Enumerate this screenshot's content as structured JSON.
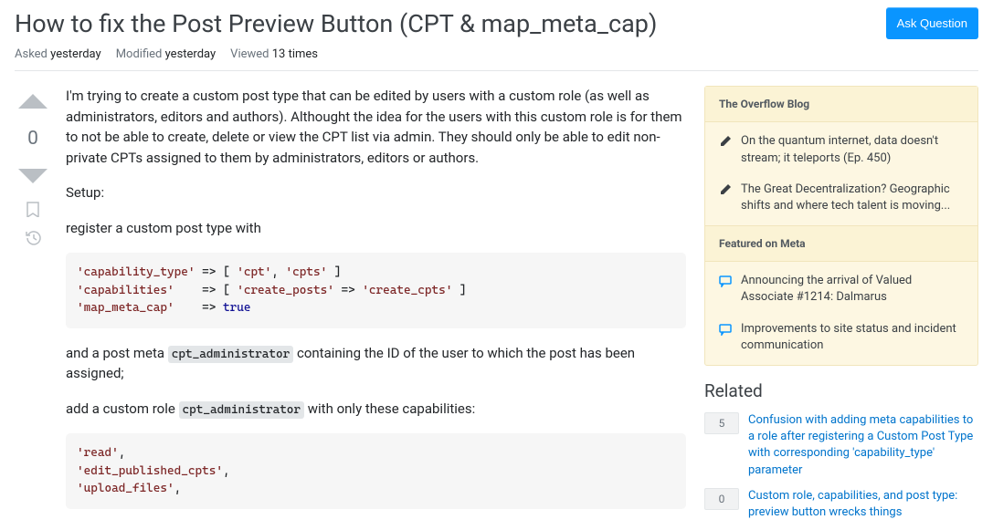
{
  "title": "How to fix the Post Preview Button (CPT & map_meta_cap)",
  "ask_button": "Ask Question",
  "stats": {
    "asked_label": "Asked",
    "asked_val": "yesterday",
    "modified_label": "Modified",
    "modified_val": "yesterday",
    "viewed_label": "Viewed",
    "viewed_val": "13 times"
  },
  "vote": {
    "count": "0"
  },
  "post": {
    "p1": "I'm trying to create a custom post type that can be edited by users with a custom role (as well as administrators, editors and authors). Althought the idea for the users with this custom role is for them to not be able to create, delete or view the CPT list via admin. They should only be able to edit non-private CPTs assigned to them by administrators, editors or authors.",
    "p2": "Setup:",
    "p3": "register a custom post type with",
    "code1_l1a": "'capability_type'",
    "code1_l1b": " => [ ",
    "code1_l1c": "'cpt'",
    "code1_l1d": ", ",
    "code1_l1e": "'cpts'",
    "code1_l1f": " ]",
    "code1_l2a": "'capabilities'",
    "code1_l2b": "    => [ ",
    "code1_l2c": "'create_posts'",
    "code1_l2d": " => ",
    "code1_l2e": "'create_cpts'",
    "code1_l2f": " ]",
    "code1_l3a": "'map_meta_cap'",
    "code1_l3b": "    => ",
    "code1_l3c": "true",
    "p4a": "and a post meta ",
    "p4code": "cpt_administrator",
    "p4b": " containing the ID of the user to which the post has been assigned;",
    "p5a": "add a custom role ",
    "p5code": "cpt_administrator",
    "p5b": " with only these capabilities:",
    "code2_l1": "'read'",
    "code2_l2": "'edit_published_cpts'",
    "code2_l3": "'upload_files'"
  },
  "sidebar": {
    "overflow_hd": "The Overflow Blog",
    "overflow": [
      {
        "text": "On the quantum internet, data doesn't stream; it teleports (Ep. 450)"
      },
      {
        "text": "The Great Decentralization? Geographic shifts and where tech talent is moving..."
      }
    ],
    "featured_hd": "Featured on Meta",
    "featured": [
      {
        "text": "Announcing the arrival of Valued Associate #1214: Dalmarus"
      },
      {
        "text": "Improvements to site status and incident communication"
      }
    ],
    "related_hd": "Related",
    "related": [
      {
        "score": "5",
        "text": "Confusion with adding meta capabilities to a role after registering a Custom Post Type with corresponding 'capability_type' parameter"
      },
      {
        "score": "0",
        "text": "Custom role, capabilities, and post type: preview button wrecks things"
      }
    ]
  }
}
